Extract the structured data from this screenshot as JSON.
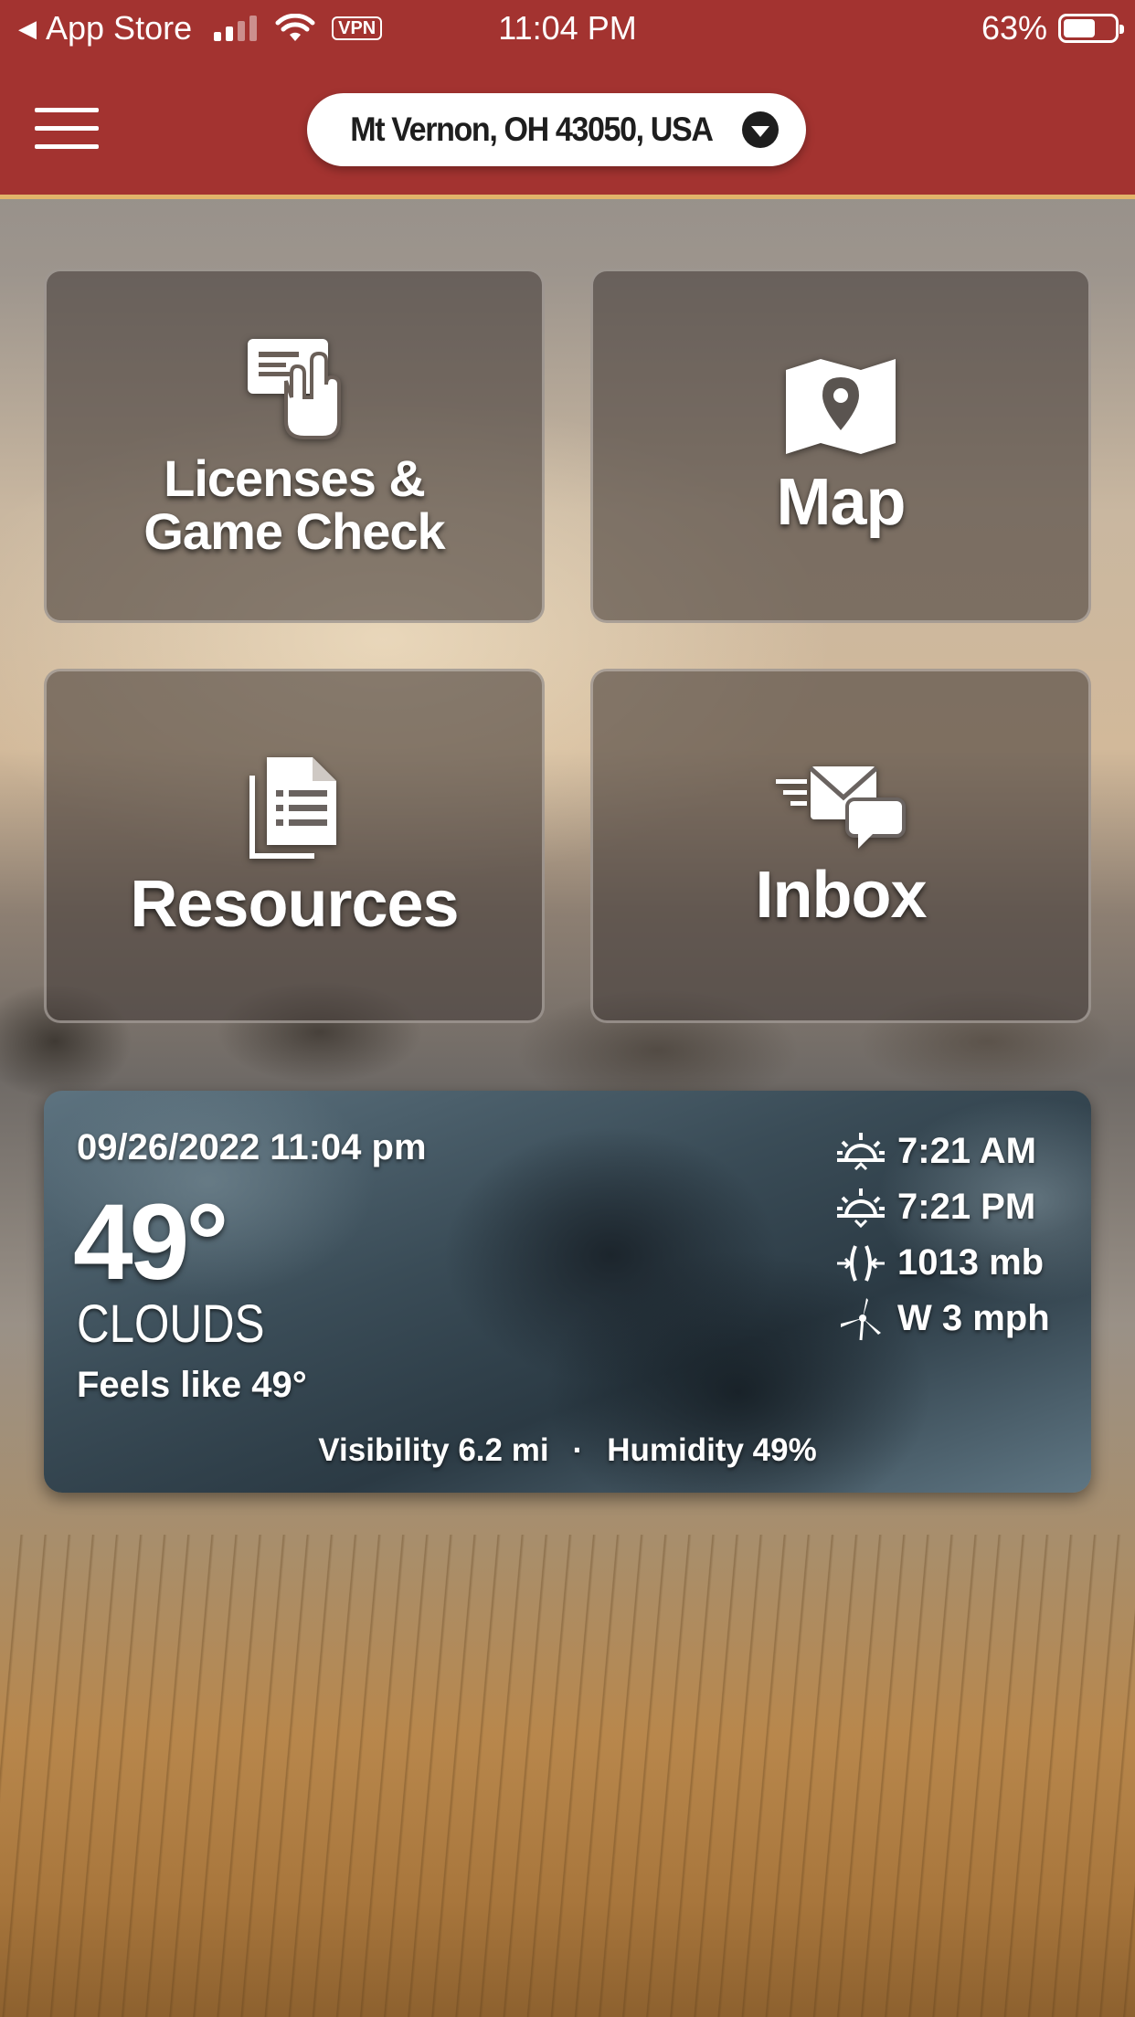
{
  "status_bar": {
    "back_label": "App Store",
    "time": "11:04 PM",
    "vpn": "VPN",
    "battery_percent_label": "63%",
    "battery_level": 0.63
  },
  "header": {
    "location": "Mt Vernon, OH 43050, USA",
    "accent_color": "#a33330"
  },
  "tiles": [
    {
      "line1": "Licenses &",
      "line2": "Game Check",
      "icon": "license-card-hand-icon"
    },
    {
      "label": "Map",
      "icon": "map-pin-icon"
    },
    {
      "label": "Resources",
      "icon": "documents-icon"
    },
    {
      "label": "Inbox",
      "icon": "envelope-chat-icon"
    }
  ],
  "weather": {
    "datetime": "09/26/2022 11:04 pm",
    "temperature": "49°",
    "condition": "CLOUDS",
    "feels_like": "Feels like 49°",
    "sunrise": "7:21 AM",
    "sunset": "7:21 PM",
    "pressure": "1013 mb",
    "wind": "W 3 mph",
    "visibility": "Visibility 6.2 mi",
    "separator": "·",
    "humidity": "Humidity 49%"
  }
}
